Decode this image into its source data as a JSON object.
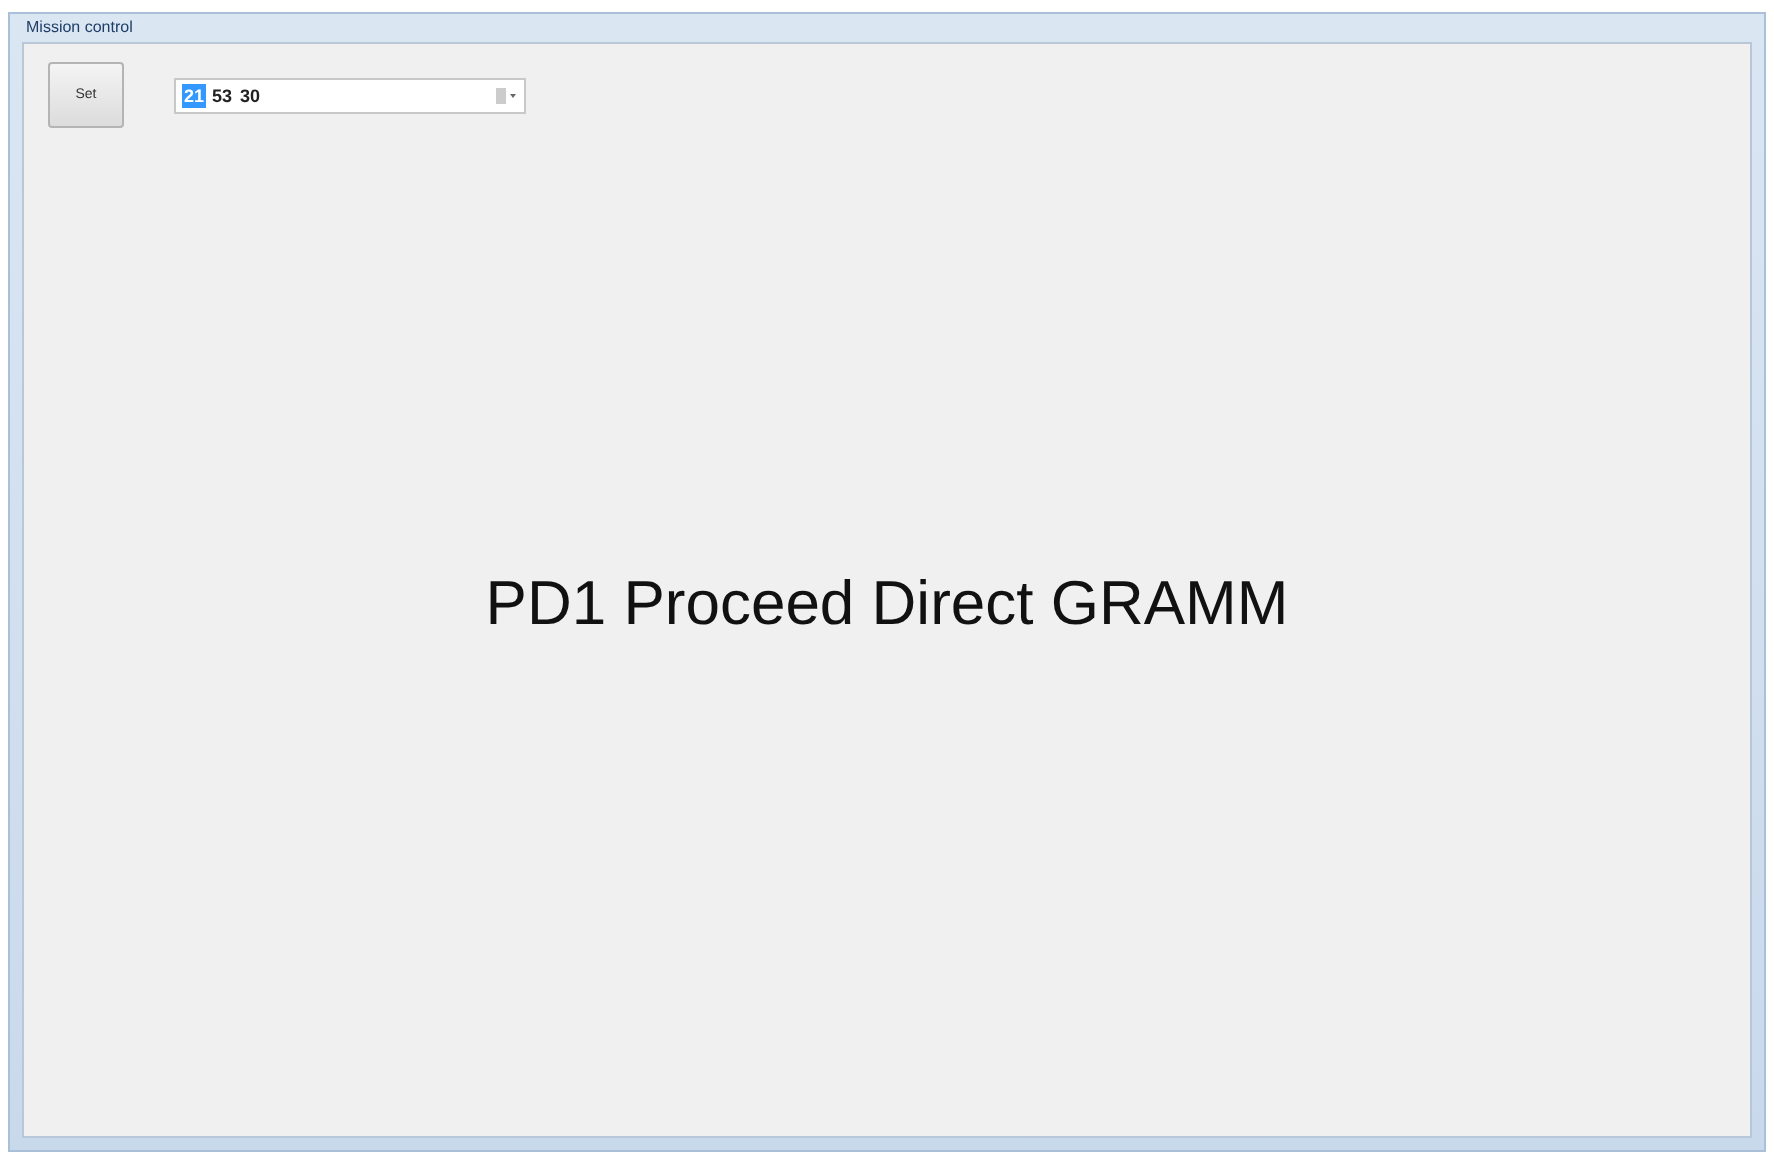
{
  "window": {
    "title": "Mission control"
  },
  "set_button": {
    "label": "Set"
  },
  "time_field": {
    "segments": [
      {
        "text": "21",
        "selected": true
      },
      {
        "text": "53",
        "selected": false
      },
      {
        "text": "30",
        "selected": false
      }
    ]
  },
  "message": "PD1 Proceed Direct GRAMM"
}
